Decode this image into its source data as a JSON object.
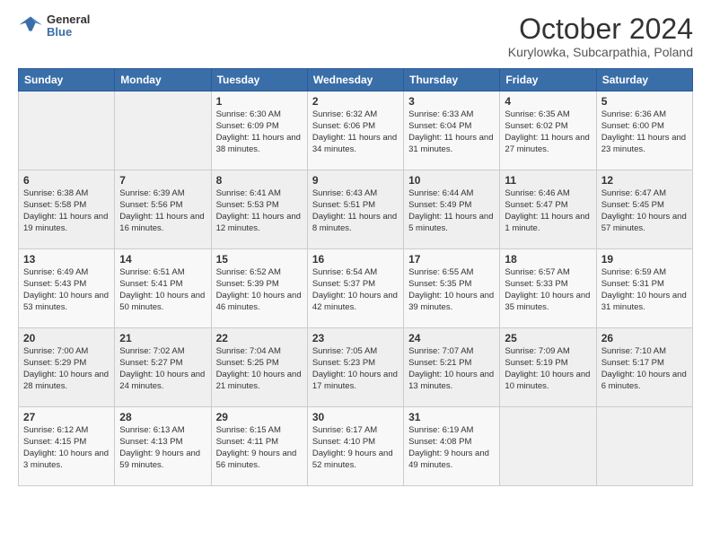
{
  "header": {
    "logo": {
      "general": "General",
      "blue": "Blue"
    },
    "title": "October 2024",
    "subtitle": "Kurylowka, Subcarpathia, Poland"
  },
  "calendar": {
    "days_of_week": [
      "Sunday",
      "Monday",
      "Tuesday",
      "Wednesday",
      "Thursday",
      "Friday",
      "Saturday"
    ],
    "weeks": [
      [
        {
          "day": "",
          "info": ""
        },
        {
          "day": "",
          "info": ""
        },
        {
          "day": "1",
          "info": "Sunrise: 6:30 AM\nSunset: 6:09 PM\nDaylight: 11 hours and 38 minutes."
        },
        {
          "day": "2",
          "info": "Sunrise: 6:32 AM\nSunset: 6:06 PM\nDaylight: 11 hours and 34 minutes."
        },
        {
          "day": "3",
          "info": "Sunrise: 6:33 AM\nSunset: 6:04 PM\nDaylight: 11 hours and 31 minutes."
        },
        {
          "day": "4",
          "info": "Sunrise: 6:35 AM\nSunset: 6:02 PM\nDaylight: 11 hours and 27 minutes."
        },
        {
          "day": "5",
          "info": "Sunrise: 6:36 AM\nSunset: 6:00 PM\nDaylight: 11 hours and 23 minutes."
        }
      ],
      [
        {
          "day": "6",
          "info": "Sunrise: 6:38 AM\nSunset: 5:58 PM\nDaylight: 11 hours and 19 minutes."
        },
        {
          "day": "7",
          "info": "Sunrise: 6:39 AM\nSunset: 5:56 PM\nDaylight: 11 hours and 16 minutes."
        },
        {
          "day": "8",
          "info": "Sunrise: 6:41 AM\nSunset: 5:53 PM\nDaylight: 11 hours and 12 minutes."
        },
        {
          "day": "9",
          "info": "Sunrise: 6:43 AM\nSunset: 5:51 PM\nDaylight: 11 hours and 8 minutes."
        },
        {
          "day": "10",
          "info": "Sunrise: 6:44 AM\nSunset: 5:49 PM\nDaylight: 11 hours and 5 minutes."
        },
        {
          "day": "11",
          "info": "Sunrise: 6:46 AM\nSunset: 5:47 PM\nDaylight: 11 hours and 1 minute."
        },
        {
          "day": "12",
          "info": "Sunrise: 6:47 AM\nSunset: 5:45 PM\nDaylight: 10 hours and 57 minutes."
        }
      ],
      [
        {
          "day": "13",
          "info": "Sunrise: 6:49 AM\nSunset: 5:43 PM\nDaylight: 10 hours and 53 minutes."
        },
        {
          "day": "14",
          "info": "Sunrise: 6:51 AM\nSunset: 5:41 PM\nDaylight: 10 hours and 50 minutes."
        },
        {
          "day": "15",
          "info": "Sunrise: 6:52 AM\nSunset: 5:39 PM\nDaylight: 10 hours and 46 minutes."
        },
        {
          "day": "16",
          "info": "Sunrise: 6:54 AM\nSunset: 5:37 PM\nDaylight: 10 hours and 42 minutes."
        },
        {
          "day": "17",
          "info": "Sunrise: 6:55 AM\nSunset: 5:35 PM\nDaylight: 10 hours and 39 minutes."
        },
        {
          "day": "18",
          "info": "Sunrise: 6:57 AM\nSunset: 5:33 PM\nDaylight: 10 hours and 35 minutes."
        },
        {
          "day": "19",
          "info": "Sunrise: 6:59 AM\nSunset: 5:31 PM\nDaylight: 10 hours and 31 minutes."
        }
      ],
      [
        {
          "day": "20",
          "info": "Sunrise: 7:00 AM\nSunset: 5:29 PM\nDaylight: 10 hours and 28 minutes."
        },
        {
          "day": "21",
          "info": "Sunrise: 7:02 AM\nSunset: 5:27 PM\nDaylight: 10 hours and 24 minutes."
        },
        {
          "day": "22",
          "info": "Sunrise: 7:04 AM\nSunset: 5:25 PM\nDaylight: 10 hours and 21 minutes."
        },
        {
          "day": "23",
          "info": "Sunrise: 7:05 AM\nSunset: 5:23 PM\nDaylight: 10 hours and 17 minutes."
        },
        {
          "day": "24",
          "info": "Sunrise: 7:07 AM\nSunset: 5:21 PM\nDaylight: 10 hours and 13 minutes."
        },
        {
          "day": "25",
          "info": "Sunrise: 7:09 AM\nSunset: 5:19 PM\nDaylight: 10 hours and 10 minutes."
        },
        {
          "day": "26",
          "info": "Sunrise: 7:10 AM\nSunset: 5:17 PM\nDaylight: 10 hours and 6 minutes."
        }
      ],
      [
        {
          "day": "27",
          "info": "Sunrise: 6:12 AM\nSunset: 4:15 PM\nDaylight: 10 hours and 3 minutes."
        },
        {
          "day": "28",
          "info": "Sunrise: 6:13 AM\nSunset: 4:13 PM\nDaylight: 9 hours and 59 minutes."
        },
        {
          "day": "29",
          "info": "Sunrise: 6:15 AM\nSunset: 4:11 PM\nDaylight: 9 hours and 56 minutes."
        },
        {
          "day": "30",
          "info": "Sunrise: 6:17 AM\nSunset: 4:10 PM\nDaylight: 9 hours and 52 minutes."
        },
        {
          "day": "31",
          "info": "Sunrise: 6:19 AM\nSunset: 4:08 PM\nDaylight: 9 hours and 49 minutes."
        },
        {
          "day": "",
          "info": ""
        },
        {
          "day": "",
          "info": ""
        }
      ]
    ]
  }
}
